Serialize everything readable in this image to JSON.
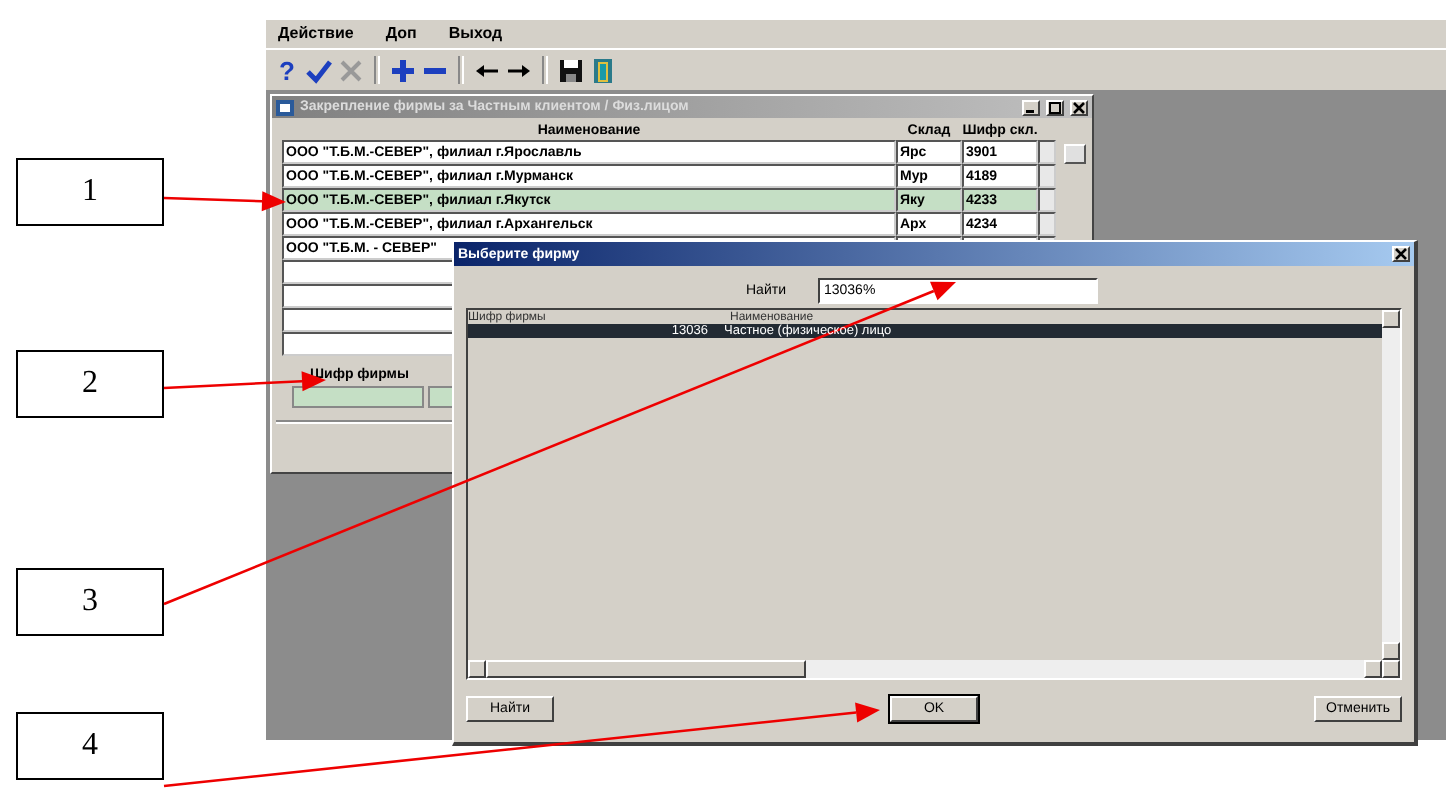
{
  "menu": [
    {
      "label": "Действие"
    },
    {
      "label": "Доп"
    },
    {
      "label": "Выход"
    }
  ],
  "toolbar": [
    {
      "kind": "text",
      "label": "?",
      "disabled": false
    },
    {
      "kind": "check",
      "disabled": false
    },
    {
      "kind": "cross",
      "disabled": true
    },
    {
      "kind": "sep"
    },
    {
      "kind": "plus",
      "disabled": false
    },
    {
      "kind": "minus",
      "disabled": false
    },
    {
      "kind": "sep"
    },
    {
      "kind": "left"
    },
    {
      "kind": "right"
    },
    {
      "kind": "sep"
    },
    {
      "kind": "save"
    },
    {
      "kind": "exit"
    }
  ],
  "inner_window": {
    "title": "Закрепление фирмы за Частным клиентом / Физ.лицом",
    "columns": [
      "Наименование",
      "Склад",
      "Шифр скл."
    ],
    "rows": [
      {
        "name": "ООО \"Т.Б.М.-СЕВЕР\", филиал г.Ярославль",
        "warehouse": "Ярс",
        "code": "3901",
        "selected": false
      },
      {
        "name": "ООО \"Т.Б.М.-СЕВЕР\", филиал г.Мурманск",
        "warehouse": "Мур",
        "code": "4189",
        "selected": false
      },
      {
        "name": "ООО \"Т.Б.М.-СЕВЕР\", филиал г.Якутск",
        "warehouse": "Яку",
        "code": "4233",
        "selected": true
      },
      {
        "name": "ООО \"Т.Б.М.-СЕВЕР\", филиал г.Архангельск",
        "warehouse": "Арх",
        "code": "4234",
        "selected": false
      },
      {
        "name": "ООО \"Т.Б.М. - СЕВЕР\"",
        "selected": false
      },
      {
        "selected": false
      },
      {
        "selected": false
      },
      {
        "selected": false
      },
      {
        "selected": false
      }
    ],
    "firm_code_label": "Шифр фирмы"
  },
  "dialog": {
    "title": "Выберите фирму",
    "search_label": "Найти",
    "search_value": "13036%",
    "columns": [
      "Шифр фирмы",
      "Наименование"
    ],
    "rows": [
      {
        "code": "13036",
        "name": "Частное (физическое) лицо",
        "selected": true
      }
    ],
    "buttons": [
      "Найти",
      "OK",
      "Отменить"
    ]
  },
  "callouts": [
    {
      "label": "1"
    },
    {
      "label": "2"
    },
    {
      "label": "3"
    },
    {
      "label": "4"
    }
  ]
}
